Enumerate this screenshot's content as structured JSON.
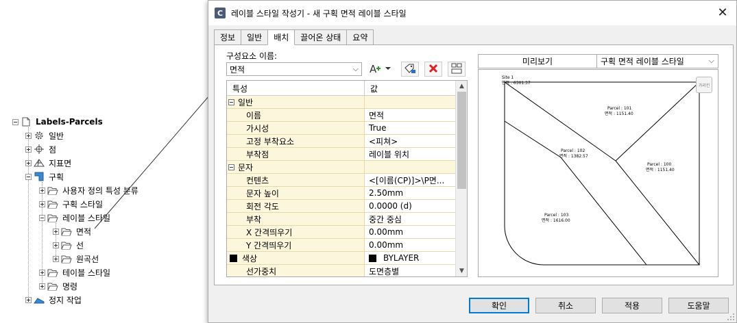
{
  "tree": {
    "root": "Labels-Parcels",
    "items": [
      {
        "label": "일반",
        "icon": "gear-icon"
      },
      {
        "label": "점",
        "icon": "point-icon"
      },
      {
        "label": "지표면",
        "icon": "surface-icon"
      },
      {
        "label": "구획",
        "icon": "parcel-icon"
      },
      {
        "label": "사용자 정의 특성 분류",
        "icon": "folder-icon"
      },
      {
        "label": "구획 스타일",
        "icon": "folder-icon"
      },
      {
        "label": "레이블 스타일",
        "icon": "folder-icon"
      },
      {
        "label": "면적",
        "icon": "folder-icon"
      },
      {
        "label": "선",
        "icon": "folder-icon"
      },
      {
        "label": "원곡선",
        "icon": "folder-icon"
      },
      {
        "label": "테이블 스타일",
        "icon": "folder-icon"
      },
      {
        "label": "명령",
        "icon": "folder-icon"
      },
      {
        "label": "정지 작업",
        "icon": "grading-icon"
      }
    ]
  },
  "dialog": {
    "title": "레이블 스타일 작성기 - 새 구획 면적 레이블 스타일",
    "app_icon_letter": "C",
    "close_glyph": "✕",
    "tabs": [
      "정보",
      "일반",
      "배치",
      "끌어온 상태",
      "요약"
    ],
    "active_tab": "배치",
    "component_label": "구성요소 이름:",
    "component_value": "면적",
    "grid": {
      "col_property": "특성",
      "col_value": "값",
      "rows": [
        {
          "type": "category",
          "name": "일반"
        },
        {
          "type": "prop",
          "name": "이름",
          "value": "면적"
        },
        {
          "type": "prop",
          "name": "가시성",
          "value": "True"
        },
        {
          "type": "prop",
          "name": "고정 부착요소",
          "value": "<피쳐>"
        },
        {
          "type": "prop",
          "name": "부착점",
          "value": "레이블 위치"
        },
        {
          "type": "category",
          "name": "문자"
        },
        {
          "type": "prop",
          "name": "컨텐츠",
          "value": "<[이름(CP)]>\\P면..."
        },
        {
          "type": "prop",
          "name": "문자 높이",
          "value": "2.50mm"
        },
        {
          "type": "prop",
          "name": "회전 각도",
          "value": "0.0000 (d)"
        },
        {
          "type": "prop",
          "name": "부착",
          "value": "중간 중심"
        },
        {
          "type": "prop",
          "name": "X 간격띄우기",
          "value": "0.00mm"
        },
        {
          "type": "prop",
          "name": "Y 간격띄우기",
          "value": "0.00mm"
        },
        {
          "type": "prop_color",
          "name": "색상",
          "value": "BYLAYER"
        },
        {
          "type": "prop",
          "name": "선가중치",
          "value": "도면층별"
        }
      ]
    },
    "preview": {
      "header": "미리보기",
      "style_select": "구획 면적 레이블 스타일",
      "site_label": "Site 1",
      "site_area": "면적 : 6301.37",
      "parcels": [
        {
          "name": "Parcel : 101",
          "area": "면적 : 1151.40"
        },
        {
          "name": "Parcel : 102",
          "area": "면적 : 1382.57"
        },
        {
          "name": "Parcel : 100",
          "area": "면적 : 1151.40"
        },
        {
          "name": "Parcel : 103",
          "area": "면적 : 1616.00"
        }
      ],
      "nav_button": "가리킨"
    },
    "buttons": {
      "ok": "확인",
      "cancel": "취소",
      "apply": "적용",
      "help": "도움말"
    }
  },
  "colors": {
    "grid_name_bg": "#fbf6dc",
    "default_button_border": "#0078d7",
    "delete_red": "#e02020"
  }
}
